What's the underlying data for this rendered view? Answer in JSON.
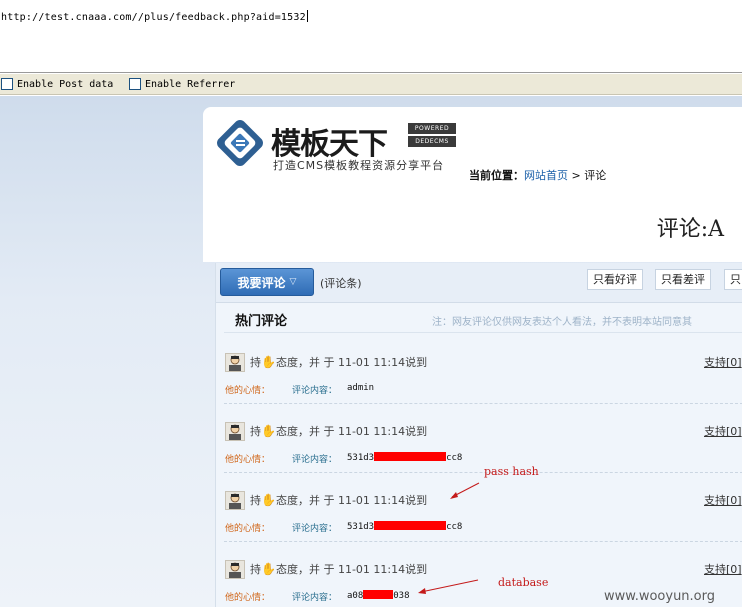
{
  "url_bar": {
    "value": "http://test.cnaaa.com//plus/feedback.php?aid=1532"
  },
  "options": [
    {
      "label": "Enable Post data"
    },
    {
      "label": "Enable Referrer"
    }
  ],
  "header": {
    "logo_title": "模板天下",
    "logo_badge": [
      "POWERED",
      "DEDECMS"
    ],
    "slogan": "打造CMS模板教程资源分享平台",
    "breadcrumb_label": "当前位置：",
    "breadcrumb_home": "网站首页",
    "breadcrumb_sep": ">",
    "breadcrumb_current": "评论",
    "page_title": "评论:A"
  },
  "toolbar": {
    "comment_button": "我要评论",
    "count_label": "(评论条)",
    "filters": [
      "只看好评",
      "只看差评",
      "只"
    ]
  },
  "hot": {
    "title": "热门评论",
    "note": "注：网友评论仅供网友表达个人看法，并不表明本站同意其"
  },
  "comments": [
    {
      "prefix": "持",
      "attitude": "态度，并 于 11-01 11:14说到",
      "support": "支持[0]",
      "mood": "他的心情：",
      "content_label": "评论内容：",
      "content_start": "admin",
      "content_end": ""
    },
    {
      "prefix": "持",
      "attitude": "态度，并 于 11-01 11:14说到",
      "support": "支持[0]",
      "mood": "他的心情：",
      "content_label": "评论内容：",
      "content_start": "531d3",
      "content_end": "cc8"
    },
    {
      "prefix": "持",
      "attitude": "态度，并 于 11-01 11:14说到",
      "support": "支持[0]",
      "mood": "他的心情：",
      "content_label": "评论内容：",
      "content_start": "531d3",
      "content_end": "cc8"
    },
    {
      "prefix": "持",
      "attitude": "态度，并 于 11-01 11:14说到",
      "support": "支持[0]",
      "mood": "他的心情：",
      "content_label": "评论内容：",
      "content_start": "a08",
      "content_end": "038"
    }
  ],
  "annotations": {
    "hash": "pass hash",
    "database": "database"
  },
  "watermark": "www.wooyun.org",
  "colors": {
    "annotation": "#c41a1a",
    "redaction": "#ff0000",
    "button": "#2f6cb5"
  }
}
